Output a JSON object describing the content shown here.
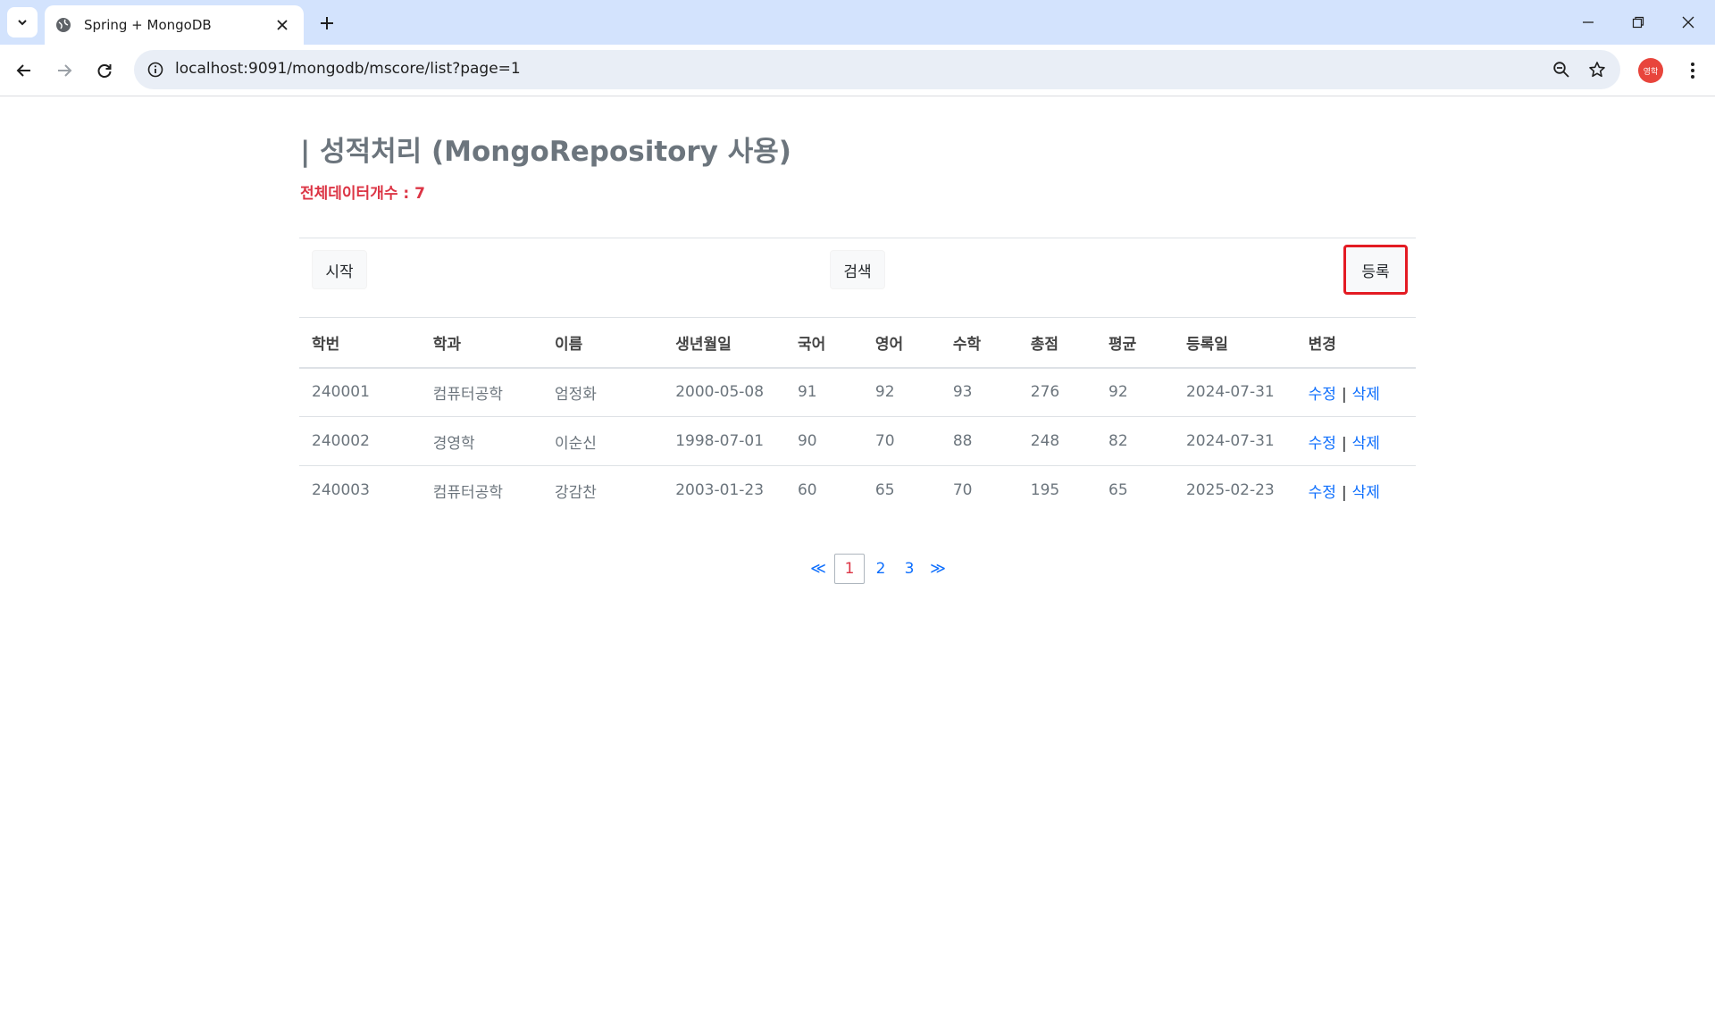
{
  "browser": {
    "tab_title": "Spring + MongoDB",
    "url": "localhost:9091/mongodb/mscore/list?page=1",
    "profile_initial": "영학"
  },
  "page": {
    "title": "| 성적처리 (MongoRepository 사용)",
    "count_label": "전체데이터개수 : 7"
  },
  "buttons": {
    "start": "시작",
    "search": "검색",
    "register": "등록"
  },
  "table": {
    "headers": [
      "학번",
      "학과",
      "이름",
      "생년월일",
      "국어",
      "영어",
      "수학",
      "총점",
      "평균",
      "등록일",
      "변경"
    ],
    "rows": [
      {
        "id": "240001",
        "dept": "컴퓨터공학",
        "name": "엄정화",
        "birth": "2000-05-08",
        "kor": "91",
        "eng": "92",
        "math": "93",
        "total": "276",
        "avg": "92",
        "regdate": "2024-07-31"
      },
      {
        "id": "240002",
        "dept": "경영학",
        "name": "이순신",
        "birth": "1998-07-01",
        "kor": "90",
        "eng": "70",
        "math": "88",
        "total": "248",
        "avg": "82",
        "regdate": "2024-07-31"
      },
      {
        "id": "240003",
        "dept": "컴퓨터공학",
        "name": "강감찬",
        "birth": "2003-01-23",
        "kor": "60",
        "eng": "65",
        "math": "70",
        "total": "195",
        "avg": "65",
        "regdate": "2025-02-23"
      }
    ],
    "edit_label": "수정",
    "delete_label": "삭제",
    "separator": "|"
  },
  "pagination": {
    "prev": "≪",
    "pages": [
      "1",
      "2",
      "3"
    ],
    "current": "1",
    "next": "≫"
  },
  "colors": {
    "title": "#6c757d",
    "count": "#dc3545",
    "link": "#0d6efd",
    "highlight_border": "#e31b23"
  }
}
